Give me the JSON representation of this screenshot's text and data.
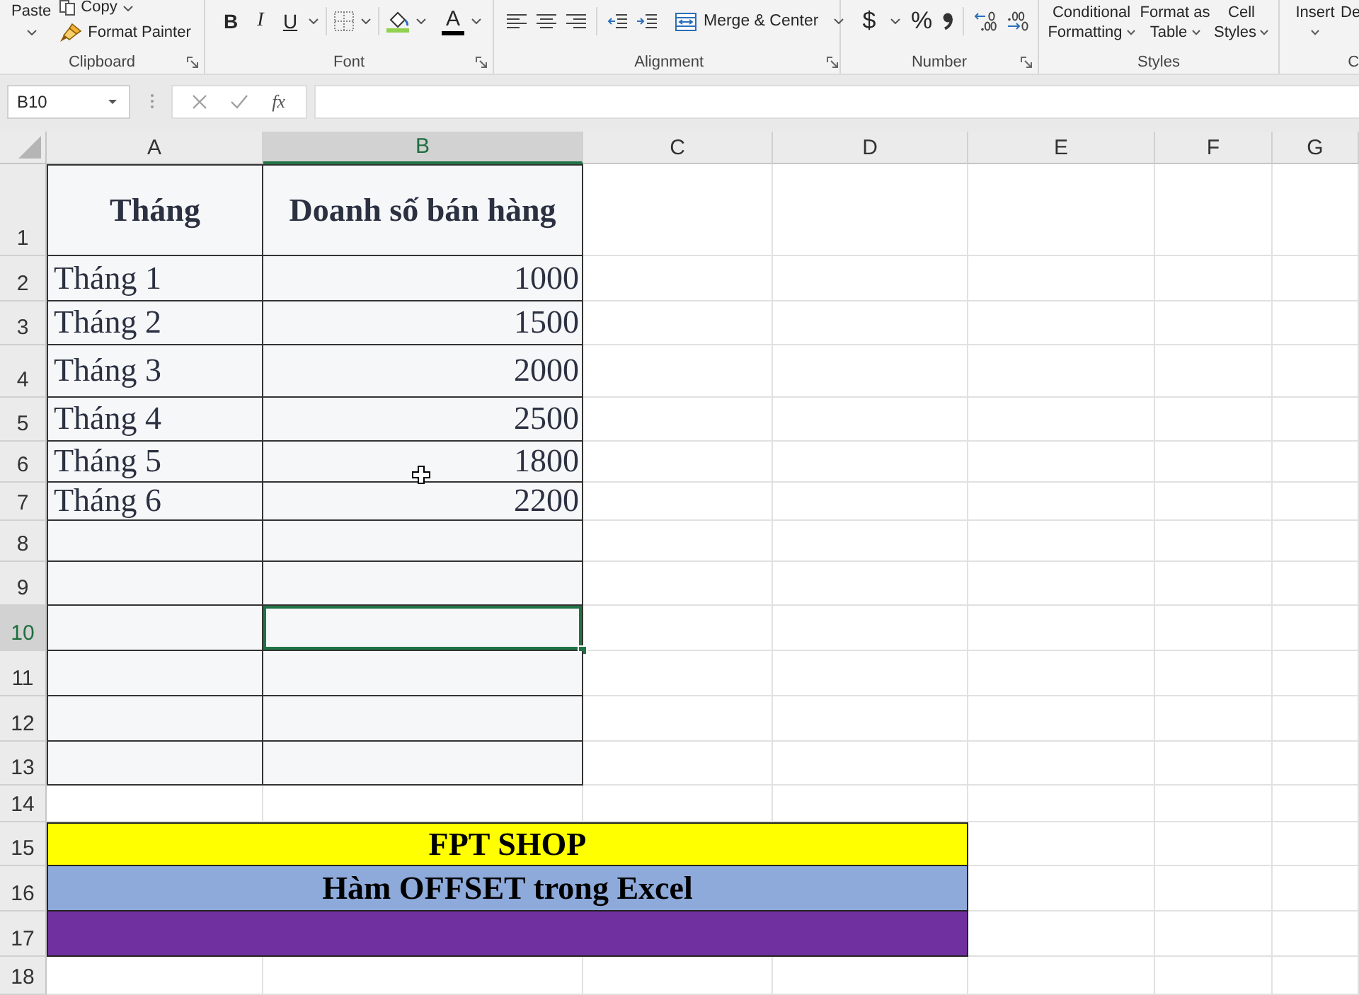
{
  "ribbon": {
    "clipboard": {
      "label": "Clipboard",
      "paste": "Paste",
      "copy": "Copy",
      "format_painter": "Format Painter"
    },
    "font": {
      "label": "Font",
      "bold": "B",
      "italic": "I",
      "underline": "U",
      "font_color": "A"
    },
    "alignment": {
      "label": "Alignment",
      "merge": "Merge & Center"
    },
    "number": {
      "label": "Number",
      "currency": "$",
      "percent": "%"
    },
    "styles": {
      "label": "Styles",
      "buttons": [
        {
          "lines": [
            "Conditional",
            "Formatting"
          ]
        },
        {
          "lines": [
            "Format as",
            "Table"
          ]
        },
        {
          "lines": [
            "Cell",
            "Styles"
          ]
        }
      ]
    },
    "group_6": {
      "label": "C",
      "insert": "Insert",
      "button_2": "De"
    }
  },
  "formula_bar": {
    "name_box": "B10",
    "function_label": "fx"
  },
  "sheet": {
    "columns": [
      {
        "label": "A",
        "selected": false
      },
      {
        "label": "B",
        "selected": true
      },
      {
        "label": "C",
        "selected": false
      },
      {
        "label": "D",
        "selected": false
      },
      {
        "label": "E",
        "selected": false
      },
      {
        "label": "F",
        "selected": false
      },
      {
        "label": "G",
        "selected": false
      }
    ],
    "rows": [
      {
        "label": "1",
        "selected": false,
        "kind": "header",
        "cells": [
          {
            "text": "Tháng",
            "selected": false
          },
          {
            "text": "Doanh số bán hàng",
            "selected": false
          }
        ]
      },
      {
        "label": "2",
        "selected": false,
        "kind": "data",
        "cells": [
          {
            "text": "Tháng 1",
            "selected": false
          },
          {
            "text": "1000",
            "selected": false
          }
        ]
      },
      {
        "label": "3",
        "selected": false,
        "kind": "data",
        "cells": [
          {
            "text": "Tháng 2",
            "selected": false
          },
          {
            "text": "1500",
            "selected": false
          }
        ]
      },
      {
        "label": "4",
        "selected": false,
        "kind": "data",
        "cells": [
          {
            "text": "Tháng 3",
            "selected": false
          },
          {
            "text": "2000",
            "selected": false
          }
        ]
      },
      {
        "label": "5",
        "selected": false,
        "kind": "data",
        "cells": [
          {
            "text": "Tháng 4",
            "selected": false
          },
          {
            "text": "2500",
            "selected": false
          }
        ]
      },
      {
        "label": "6",
        "selected": false,
        "kind": "data",
        "cells": [
          {
            "text": "Tháng 5",
            "selected": false
          },
          {
            "text": "1800",
            "selected": false
          }
        ]
      },
      {
        "label": "7",
        "selected": false,
        "kind": "data",
        "cells": [
          {
            "text": "Tháng 6",
            "selected": false
          },
          {
            "text": "2200",
            "selected": false
          }
        ]
      },
      {
        "label": "8",
        "selected": false,
        "kind": "data",
        "cells": [
          {
            "selected": false
          },
          {
            "selected": false
          }
        ]
      },
      {
        "label": "9",
        "selected": false,
        "kind": "data",
        "cells": [
          {
            "selected": false
          },
          {
            "selected": false
          }
        ]
      },
      {
        "label": "10",
        "selected": true,
        "kind": "data",
        "cells": [
          {
            "selected": false
          },
          {
            "selected": true
          }
        ]
      },
      {
        "label": "11",
        "selected": false,
        "kind": "data",
        "cells": [
          {
            "selected": false
          },
          {
            "selected": false
          }
        ]
      },
      {
        "label": "12",
        "selected": false,
        "kind": "data",
        "cells": [
          {
            "selected": false
          },
          {
            "selected": false
          }
        ]
      },
      {
        "label": "13",
        "selected": false,
        "kind": "data",
        "cells": [
          {
            "selected": false
          },
          {
            "selected": false
          }
        ]
      },
      {
        "label": "14",
        "selected": false,
        "kind": "blank"
      },
      {
        "label": "15",
        "selected": false,
        "kind": "banner",
        "banner": {
          "text": "FPT SHOP",
          "color": "#ffff00"
        }
      },
      {
        "label": "16",
        "selected": false,
        "kind": "banner",
        "banner": {
          "text": "Hàm OFFSET trong Excel",
          "color": "#8eaadb"
        }
      },
      {
        "label": "17",
        "selected": false,
        "kind": "banner",
        "banner": {
          "color": "#7030a0"
        }
      },
      {
        "label": "18",
        "selected": false,
        "kind": "blank"
      }
    ]
  }
}
